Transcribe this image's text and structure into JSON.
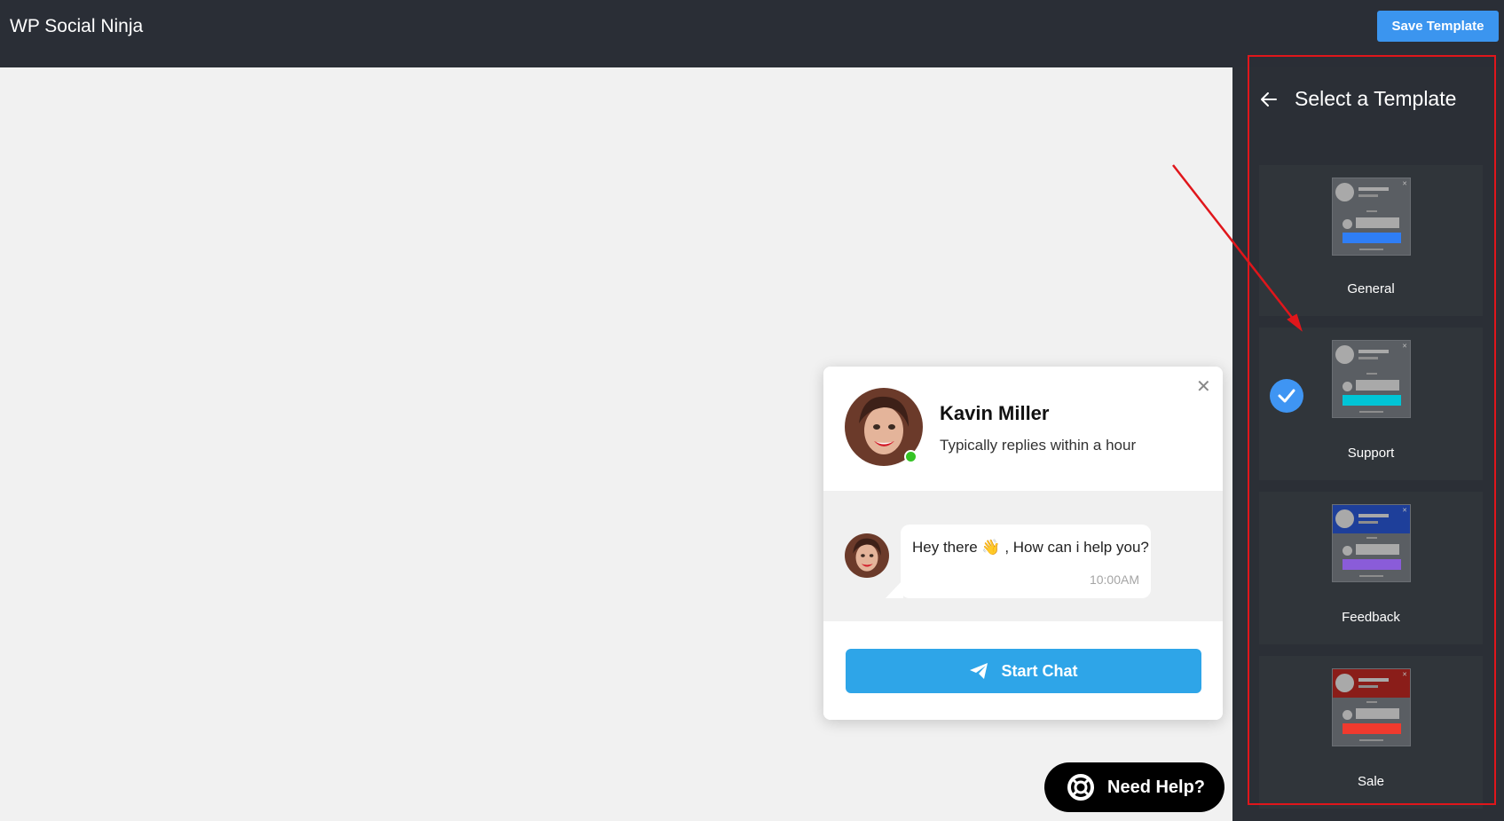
{
  "app": {
    "title": "WP Social Ninja"
  },
  "toolbar": {
    "save_label": "Save Template",
    "save_color": "#3b95ef"
  },
  "sidebar": {
    "title": "Select a Template",
    "back_icon": "arrow-left-icon",
    "selected": "Support",
    "templates": [
      {
        "label": "General",
        "accent": "#2f7ef5",
        "header": "#5a5e63"
      },
      {
        "label": "Support",
        "accent": "#00c5d6",
        "header": "#5a5e63"
      },
      {
        "label": "Feedback",
        "accent": "#8a5cd9",
        "header": "#1e3f9a"
      },
      {
        "label": "Sale",
        "accent": "#f03a2e",
        "header": "#8a1d19"
      }
    ]
  },
  "chat": {
    "agent_name": "Kavin Miller",
    "agent_status": "Typically replies within a hour",
    "message": "Hey there 👋 , How can i help you?",
    "message_time": "10:00AM",
    "button_label": "Start Chat",
    "button_color": "#2ea5e8"
  },
  "help": {
    "label": "Need Help?"
  },
  "annotation": {
    "color": "#e0161b"
  }
}
